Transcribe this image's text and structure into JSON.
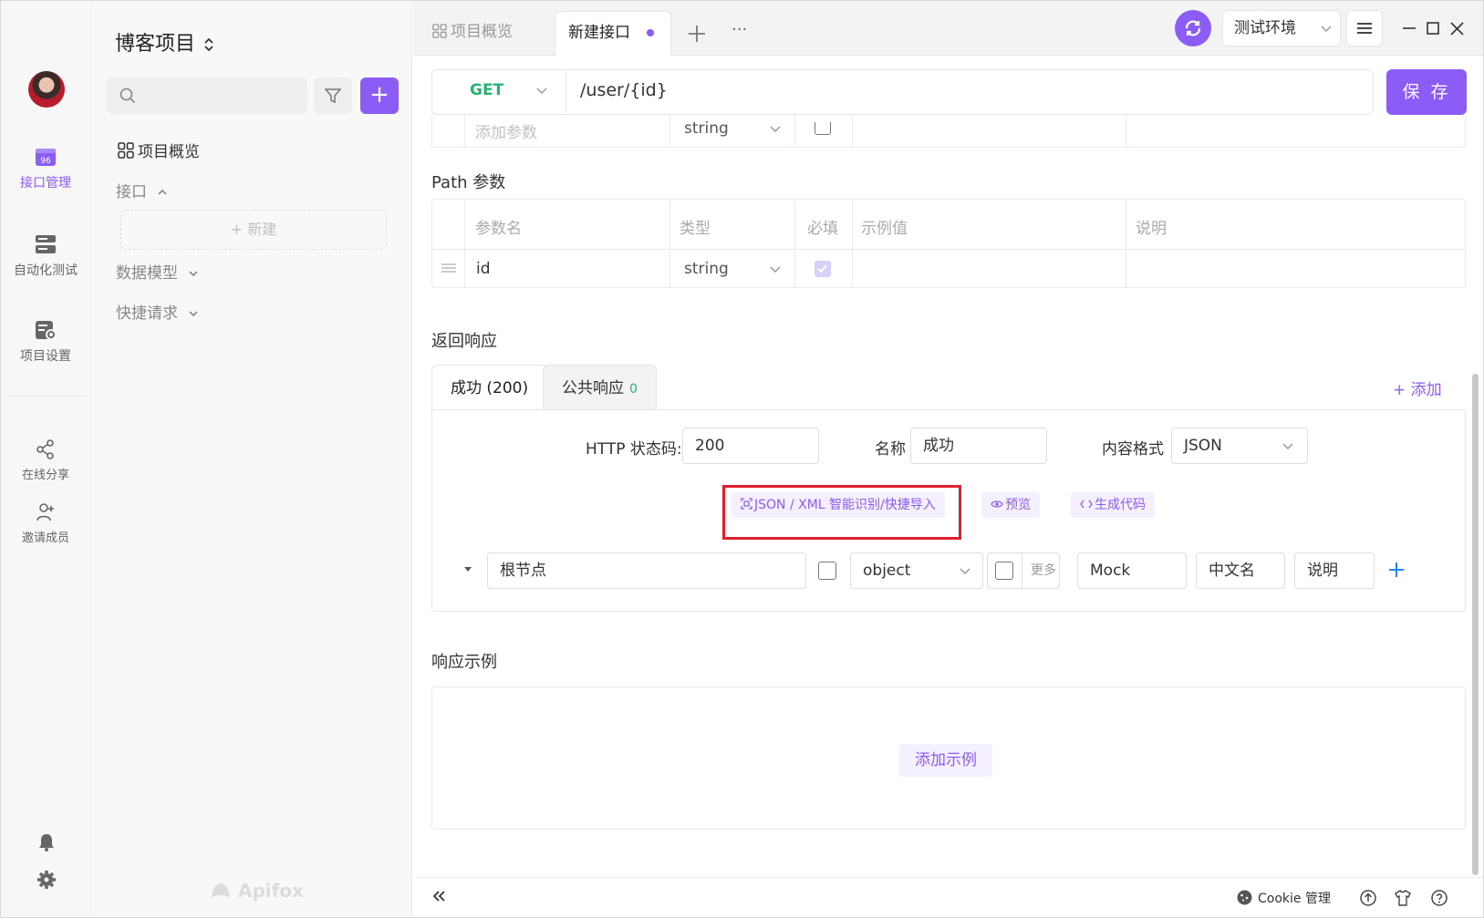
{
  "rail": {
    "items": [
      {
        "label": "接口管理",
        "icon": "api-management-icon",
        "active": true
      },
      {
        "label": "自动化测试",
        "icon": "automation-test-icon"
      },
      {
        "label": "项目设置",
        "icon": "project-settings-icon"
      },
      {
        "label": "在线分享",
        "icon": "share-icon"
      },
      {
        "label": "邀请成员",
        "icon": "invite-member-icon"
      }
    ]
  },
  "sidebar": {
    "project_title": "博客项目",
    "overview": "项目概览",
    "interfaces": "接口",
    "new_label": "+ 新建",
    "data_models": "数据模型",
    "quick_requests": "快捷请求",
    "brand": "Apifox"
  },
  "tabs": [
    {
      "label": "项目概览",
      "active": false
    },
    {
      "label": "新建接口",
      "active": true
    }
  ],
  "toolbar": {
    "env": "测试环境",
    "more": "···"
  },
  "request": {
    "method": "GET",
    "url": "/user/{id}",
    "save": "保 存"
  },
  "query_row": {
    "name_placeholder": "添加参数",
    "type": "string"
  },
  "path_params": {
    "title": "Path 参数",
    "headers": [
      "参数名",
      "类型",
      "必填",
      "示例值",
      "说明"
    ],
    "row": {
      "name": "id",
      "type": "string",
      "required": true
    }
  },
  "response": {
    "title": "返回响应",
    "tab_success": "成功 (200)",
    "tab_common": "公共响应",
    "tab_common_count": "0",
    "add": "+ 添加",
    "http_code_label": "HTTP 状态码:",
    "http_code": "200",
    "name_label": "名称",
    "name": "成功",
    "format_label": "内容格式",
    "format": "JSON",
    "import_btn": "JSON / XML 智能识别/快捷导入",
    "preview_btn": "预览",
    "codegen_btn": "生成代码",
    "root_node": "根节点",
    "root_type": "object",
    "more": "更多",
    "mock_ph": "Mock",
    "cn_name_ph": "中文名",
    "desc_ph": "说明"
  },
  "example": {
    "title": "响应示例",
    "add": "添加示例"
  },
  "footer": {
    "cookie": "Cookie 管理"
  },
  "colors": {
    "accent": "#8b5cf6",
    "get_method": "#22b573",
    "highlight": "#e02030"
  }
}
